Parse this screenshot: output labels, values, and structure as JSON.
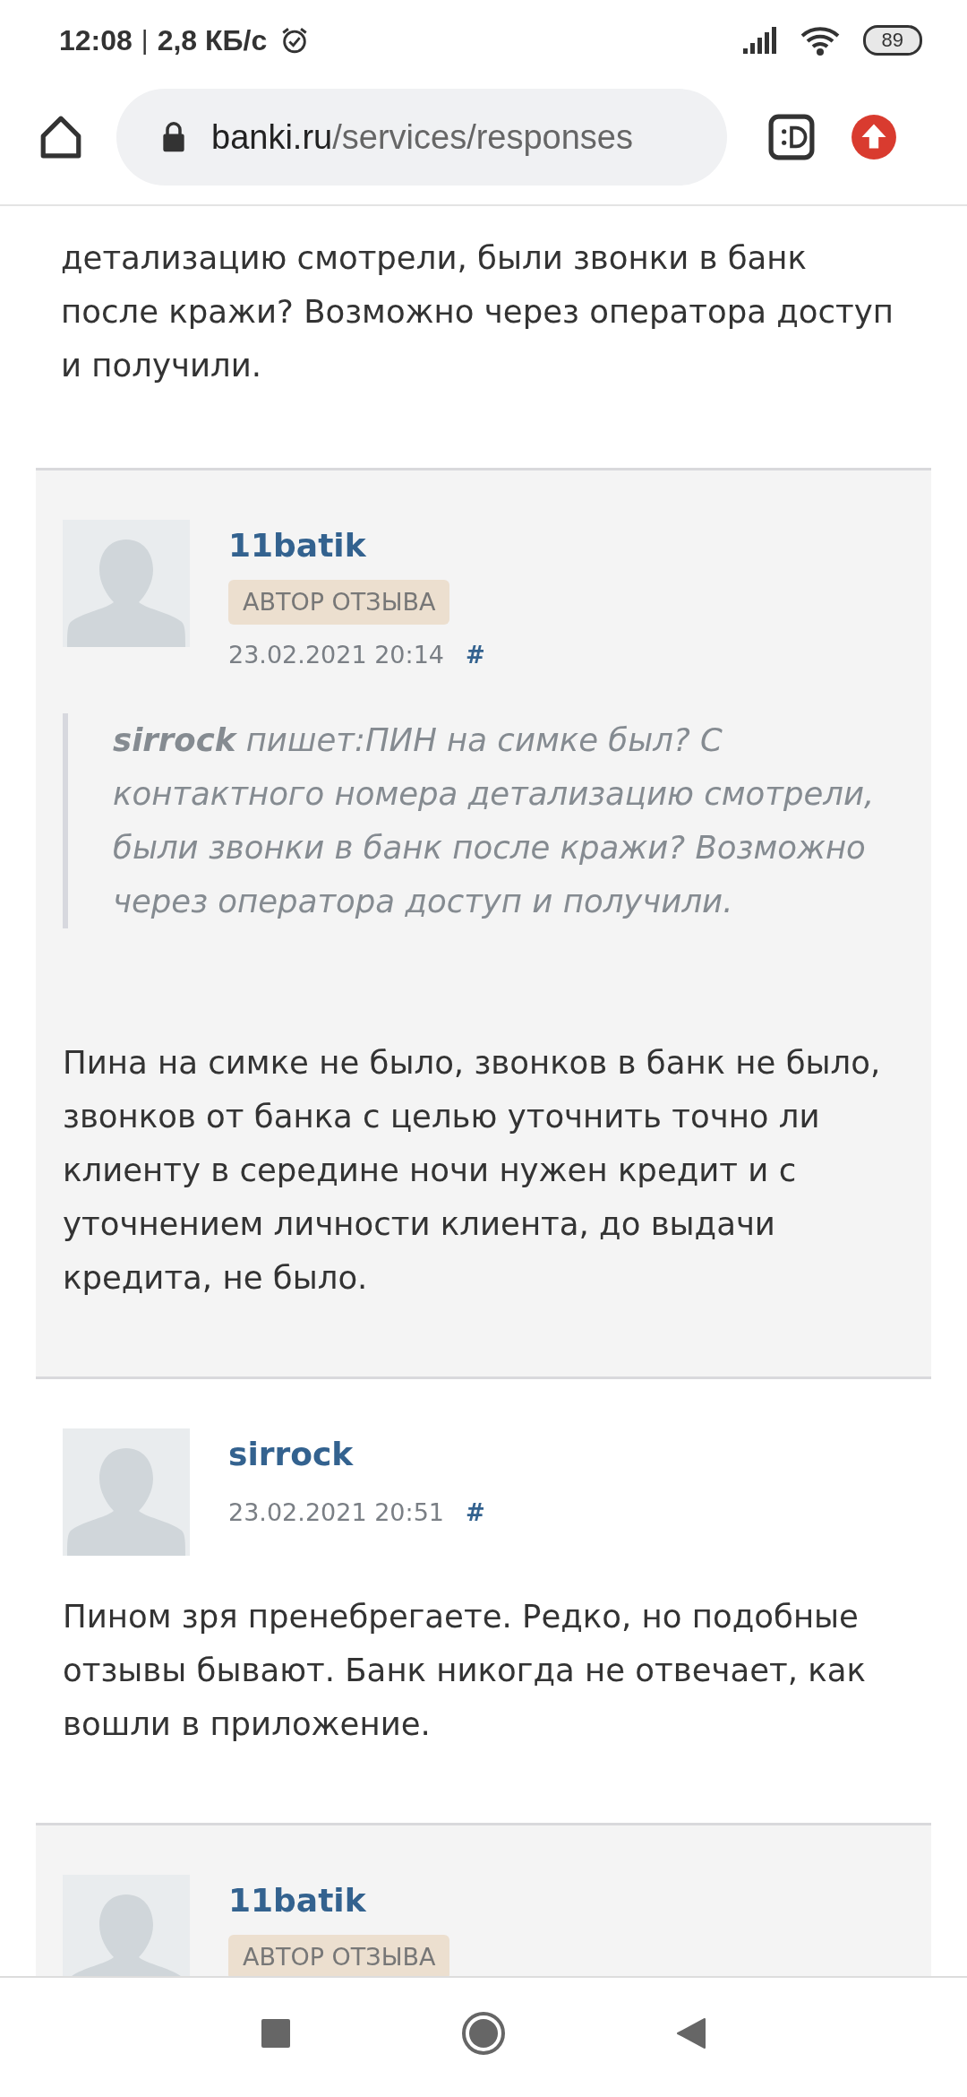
{
  "status_bar": {
    "time": "12:08",
    "separator": "|",
    "speed": "2,8 КБ/с",
    "battery": "89"
  },
  "browser": {
    "domain": "banki.ru",
    "path": "/services/responses"
  },
  "top_text": "детализацию смотрели, были звонки в банк после кражи? Возможно через оператора доступ и получили.",
  "comments": [
    {
      "author": "11batik",
      "highlighted": true,
      "badge": "АВТОР ОТЗЫВА",
      "date": "23.02.2021 20:14",
      "anchor": "#",
      "quote": "**sirrock** пишет:ПИН на симке был? С контактного номера детализацию смотрели, были звонки в банк после кражи? Возможно через оператора доступ и получили.",
      "text": "Пина на симке не было, звонков в банк не было, звонков от банка с целью уточнить точно ли клиенту в середине ночи нужен кредит и с уточнением личности клиента, до выдачи кредита, не было."
    },
    {
      "author": "sirrock",
      "highlighted": false,
      "date": "23.02.2021 20:51",
      "anchor": "#",
      "text": "Пином зря пренебрегаете. Редко, но подобные отзывы бывают. Банк никогда не отвечает, как вошли в приложение."
    },
    {
      "author": "11batik",
      "highlighted": true,
      "badge": "АВТОР ОТЗЫВА"
    }
  ]
}
